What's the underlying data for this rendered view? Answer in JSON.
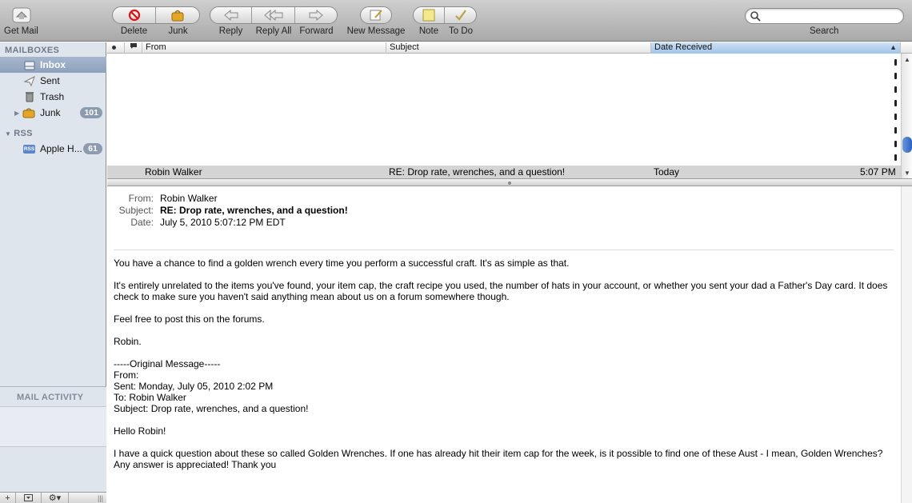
{
  "toolbar": {
    "get_mail": "Get Mail",
    "delete": "Delete",
    "junk": "Junk",
    "reply": "Reply",
    "reply_all": "Reply All",
    "forward": "Forward",
    "new_message": "New Message",
    "note": "Note",
    "todo": "To Do",
    "search_label": "Search",
    "search_placeholder": ""
  },
  "sidebar": {
    "mailboxes_header": "MAILBOXES",
    "items": [
      {
        "label": "Inbox",
        "icon": "inbox-tray-icon",
        "selected": true
      },
      {
        "label": "Sent",
        "icon": "paper-plane-icon"
      },
      {
        "label": "Trash",
        "icon": "trash-can-icon"
      },
      {
        "label": "Junk",
        "icon": "junk-bag-icon",
        "badge": "101"
      }
    ],
    "rss_header": "RSS",
    "rss_items": [
      {
        "label": "Apple H...",
        "icon": "rss-feed-icon",
        "badge": "61"
      }
    ],
    "activity_header": "MAIL ACTIVITY"
  },
  "list": {
    "columns": {
      "from": "From",
      "subject": "Subject",
      "date_received": "Date Received"
    },
    "selected_message": {
      "from": "Robin Walker",
      "subject": "RE: Drop rate, wrenches, and a question!",
      "date": "Today",
      "time": "5:07 PM"
    }
  },
  "message": {
    "from_label": "From:",
    "from": "Robin Walker",
    "subject_label": "Subject:",
    "subject": "RE: Drop rate, wrenches, and a question!",
    "date_label": "Date:",
    "date": "July 5, 2010 5:07:12 PM EDT",
    "body": {
      "p1": "You have a chance to find a golden wrench every time you perform a successful craft. It's as simple as that.",
      "p2a": "It's entirely unrelated to the items you've found, your item cap, the craft recipe you used, the number of hats in your account, or whether you sent your dad a Father's Day card. It does",
      "p2b": "check to make sure you haven't said anything mean about us on a forum somewhere though.",
      "p3": "Feel free to post this on the forums.",
      "p4": "Robin.",
      "orig_header": "-----Original Message-----",
      "orig_from": "From: ",
      "orig_sent": "Sent: Monday, July 05, 2010 2:02 PM",
      "orig_to": "To: Robin Walker",
      "orig_subject": "Subject: Drop rate, wrenches, and a question!",
      "p5": "Hello Robin!",
      "p6a": "I have a quick question about these so called Golden Wrenches. If one has already hit their item cap for the week, is it possible to find one of these Aust - I mean, Golden Wrenches?",
      "p6b": "Any answer is appreciated! Thank you"
    }
  }
}
